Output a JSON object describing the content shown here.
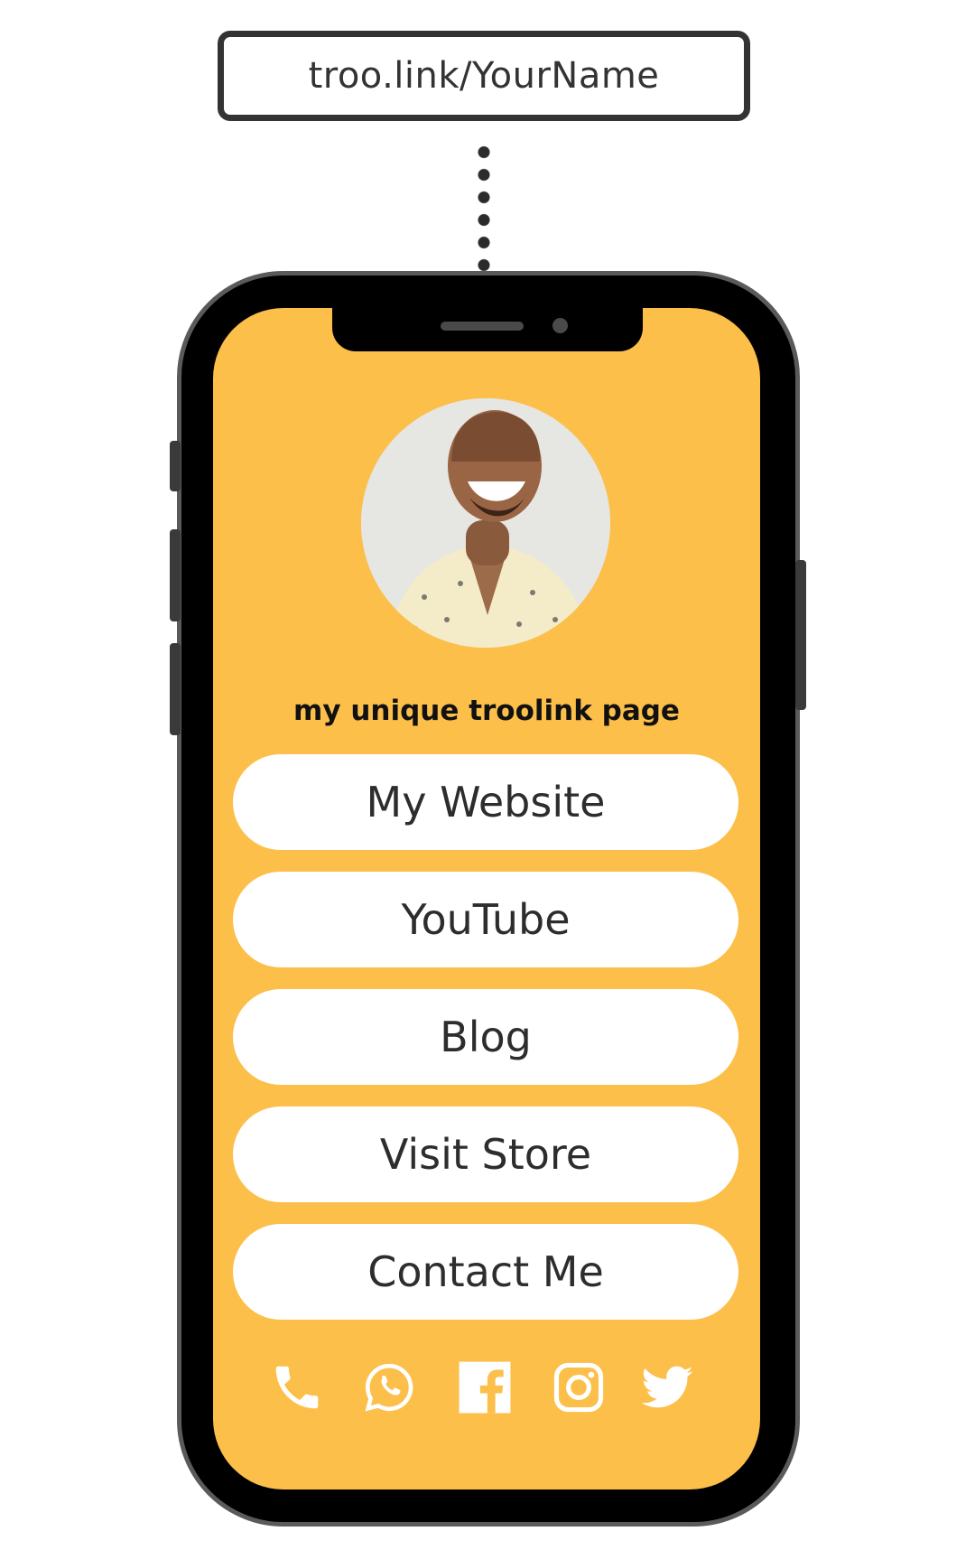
{
  "url_bar": {
    "text": "troo.link/YourName"
  },
  "profile": {
    "title": "my unique troolink page",
    "avatar_alt": "profile-photo"
  },
  "links": [
    {
      "label": "My Website"
    },
    {
      "label": "YouTube"
    },
    {
      "label": "Blog"
    },
    {
      "label": "Visit Store"
    },
    {
      "label": "Contact Me"
    }
  ],
  "social_icons": [
    "phone-icon",
    "whatsapp-icon",
    "facebook-icon",
    "instagram-icon",
    "twitter-icon"
  ],
  "colors": {
    "screen_background": "#fcbf4a",
    "button_background": "#ffffff",
    "phone_body": "#000000",
    "icon": "#ffffff"
  }
}
